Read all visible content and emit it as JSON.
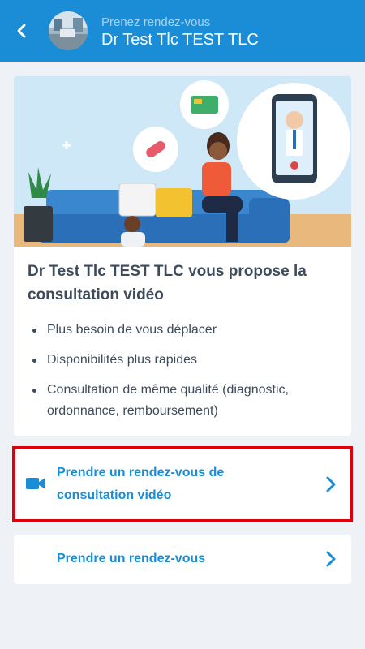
{
  "header": {
    "subtitle": "Prenez rendez-vous",
    "doctor_name": "Dr Test Tlc TEST TLC",
    "back_icon": "chevron-left-icon"
  },
  "promo": {
    "title": "Dr Test Tlc TEST TLC vous propose la consultation vidéo",
    "benefits": [
      "Plus besoin de vous déplacer",
      "Disponibilités plus rapides",
      "Consultation de même qualité (diagnostic, ordonnance, remboursement)"
    ]
  },
  "options": {
    "video": {
      "label": "Prendre un rendez-vous de consultation vidéo",
      "icon": "video-camera-icon",
      "highlighted": true
    },
    "standard": {
      "label": "Prendre un rendez-vous"
    },
    "chevron_icon": "chevron-right-icon"
  },
  "colors": {
    "brand_blue": "#1b8dd6",
    "page_background": "#eef1f5",
    "text_dark": "#3d4b5a",
    "highlight_red": "#e0000b"
  }
}
